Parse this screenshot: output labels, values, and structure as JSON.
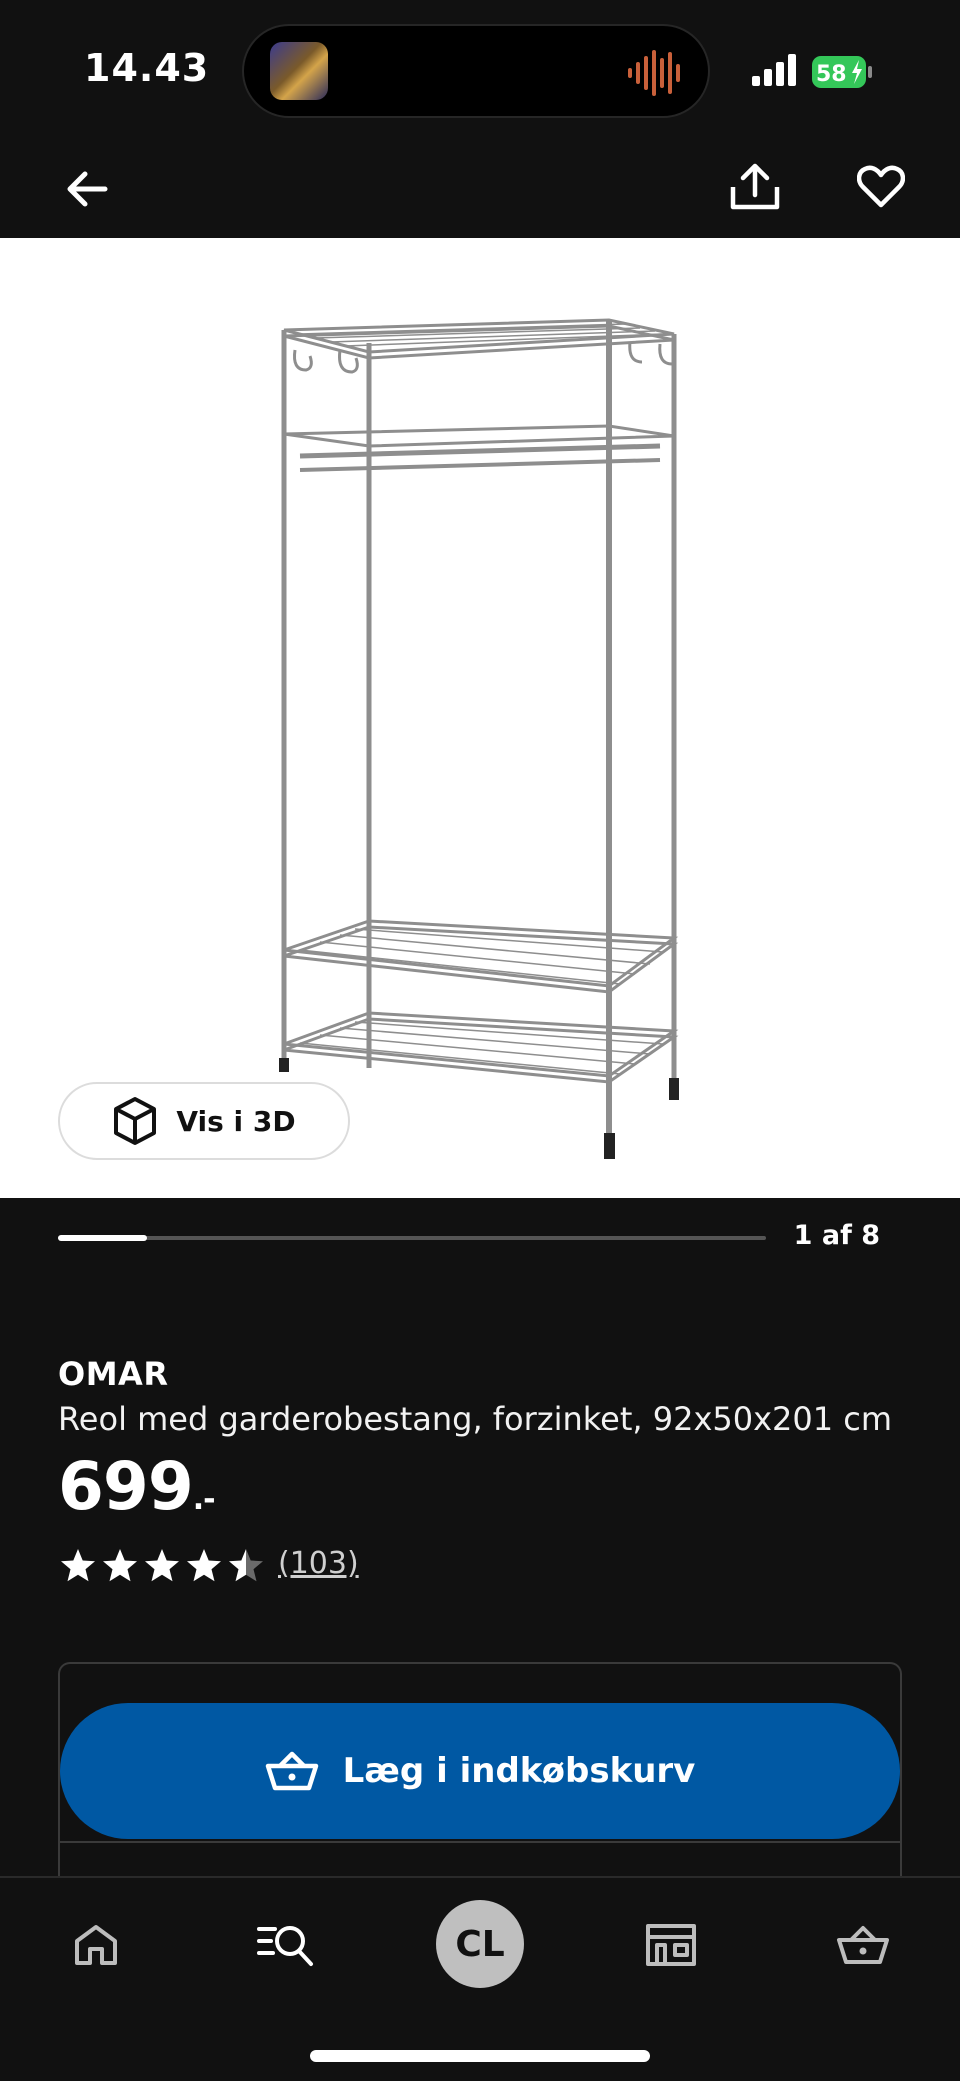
{
  "status_bar": {
    "time": "14.43",
    "battery_level": "58"
  },
  "nav": {
    "back_icon": "arrow-left-icon",
    "share_icon": "share-icon",
    "favorite_icon": "heart-icon"
  },
  "gallery": {
    "view_3d_label": "Vis i 3D",
    "page_indicator": "1 af 8",
    "current_image": 1,
    "total_images": 8
  },
  "product": {
    "brand": "OMAR",
    "description": "Reol med garderobestang, forzinket, 92x50x201 cm",
    "price": "699",
    "price_suffix": ".-",
    "rating_value": 4.5,
    "rating_max": 5,
    "review_count": "(103)"
  },
  "cart": {
    "add_to_cart_label": "Læg i indkøbskurv"
  },
  "tab_bar": {
    "home_icon": "home-icon",
    "search_icon": "search-icon",
    "profile_initials": "CL",
    "store_icon": "store-icon",
    "basket_icon": "basket-icon"
  },
  "colors": {
    "background": "#111111",
    "accent_blue": "#0058a3",
    "battery_green": "#34c759"
  }
}
